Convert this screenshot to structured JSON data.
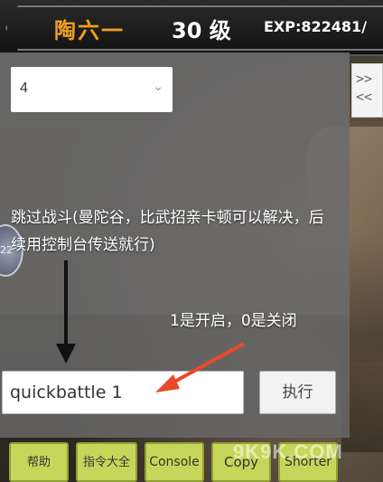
{
  "header": {
    "player_name": "陶六一",
    "level": "30 级",
    "exp": "EXP:822481/"
  },
  "console": {
    "select_value": "4",
    "toggle_label": ">>\n<<",
    "avatar_text": "22",
    "annotation_text": "跳过战斗(曼陀谷，比武招亲卡顿可以解决，后续用控制台传送就行)",
    "annotation_note": "1是开启，0是关闭",
    "command_value": "quickbattle 1",
    "execute_label": "执行"
  },
  "toolbar": {
    "buttons": [
      "帮助",
      "指令大全",
      "Console",
      "Copy",
      "Shorter"
    ]
  },
  "watermark": "9K9K.COM",
  "colors": {
    "name_color": "#f0a020",
    "toolbar_button": "#c6d65a",
    "arrow_black": "#111111",
    "arrow_red": "#e84a2a"
  }
}
